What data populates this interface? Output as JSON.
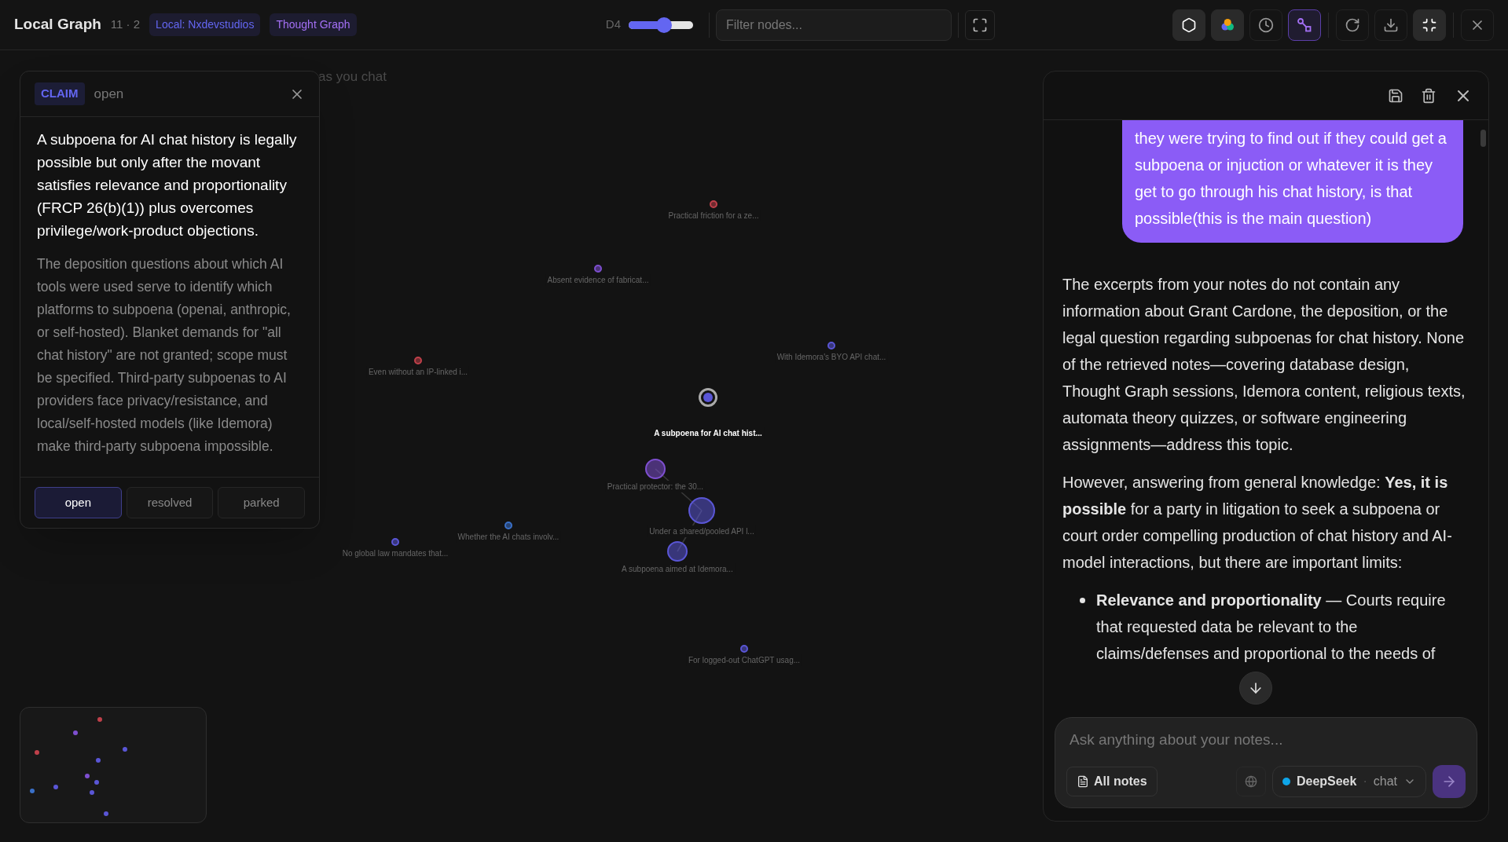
{
  "header": {
    "title": "Local Graph",
    "counts": "11 · 2",
    "tags": [
      {
        "label": "Local: Nxdevstudios",
        "color": "#6366f1"
      },
      {
        "label": "Thought Graph",
        "color": "#a470f5"
      }
    ],
    "depth": {
      "label": "D4",
      "level": 0.55
    },
    "filter": {
      "placeholder": "Filter nodes..."
    }
  },
  "toolbar": [
    {
      "kind": "hexagon",
      "on": true,
      "selected": false
    },
    {
      "kind": "colors",
      "on": true,
      "selected": false
    },
    {
      "kind": "clock",
      "on": false,
      "selected": false
    },
    {
      "kind": "link",
      "on": false,
      "selected": true
    },
    {
      "kind": "refresh",
      "on": false,
      "selected": false
    },
    {
      "kind": "download",
      "on": false,
      "selected": false
    },
    {
      "kind": "compress",
      "on": true,
      "selected": false
    },
    {
      "kind": "close",
      "on": false,
      "selected": false
    }
  ],
  "canvas": {
    "hint": "as you chat",
    "nodes": [
      {
        "label": "Practical friction for a ze...",
        "color": "#c0404a",
        "selected": false,
        "linked_to_next": false
      },
      {
        "label": "Absent evidence of fabricat...",
        "color": "#7e4fd0",
        "selected": false,
        "linked_to_next": false
      },
      {
        "label": "Even without an IP-linked i...",
        "color": "#c0404a",
        "selected": false,
        "linked_to_next": false
      },
      {
        "label": "With Idemora's BYO API chat...",
        "color": "#5a56d6",
        "selected": false,
        "linked_to_next": false
      },
      {
        "label": "A subpoena for AI chat hist...",
        "color": "#5a56d6",
        "selected": true,
        "linked_to_next": false
      },
      {
        "label": "Practical protector: the 30...",
        "color": "#7e4fd0",
        "selected": false,
        "linked_to_next": true
      },
      {
        "label": "Under a shared/pooled API l...",
        "color": "#5a56d6",
        "selected": false,
        "linked_to_next": true
      },
      {
        "label": "A subpoena aimed at Idemora...",
        "color": "#5a56d6",
        "selected": false,
        "linked_to_next": false
      },
      {
        "label": "Whether the AI chats involv...",
        "color": "#3a70c8",
        "selected": false,
        "linked_to_next": false
      },
      {
        "label": "No global law mandates that...",
        "color": "#5a56d6",
        "selected": false,
        "linked_to_next": false
      },
      {
        "label": "For logged-out ChatGPT usag...",
        "color": "#5a56d6",
        "selected": false,
        "linked_to_next": false
      }
    ]
  },
  "claim_card": {
    "badge": "CLAIM",
    "status": "open",
    "title": "A subpoena for AI chat history is legally possible but only after the movant satisfies relevance and proportionality (FRCP 26(b)(1)) plus overcomes privilege/work-product objections.",
    "body": "The deposition questions about which AI tools were used serve to identify which platforms to subpoena (openai, anthropic, or self-hosted). Blanket demands for \"all chat history\" are not granted; scope must be specified. Third-party subpoenas to AI providers face privacy/resistance, and local/self-hosted models (like Idemora) make third-party subpoena impossible.",
    "status_options": [
      {
        "label": "open",
        "selected": true
      },
      {
        "label": "resolved",
        "selected": false
      },
      {
        "label": "parked",
        "selected": false
      }
    ]
  },
  "chat": {
    "user_message": "they were trying to find out if they could get a subpoena or injuction or whatever it is they get to go through his chat history, is that possible(this is the main question)",
    "assistant": [
      {
        "kind": "paragraph",
        "text": "The excerpts from your notes do not contain any information about Grant Cardone, the deposition, or the legal question regarding subpoenas for chat history. None of the retrieved notes—covering database design, Thought Graph sessions, Idemora content, religious texts, automata theory quizzes, or software engineering assignments—address this topic."
      },
      {
        "kind": "paragraph",
        "text": "However, answering from general knowledge: **Yes, it is possible** for a party in litigation to seek a subpoena or court order compelling production of chat history and AI-model interactions, but there are important limits:"
      },
      {
        "kind": "bullet",
        "text": "**Relevance and proportionality** — Courts require that requested data be relevant to the claims/defenses and proportional to the needs of"
      }
    ],
    "input": {
      "placeholder": "Ask anything about your notes...",
      "scope": "All notes",
      "model": {
        "name": "DeepSeek",
        "separator": "·",
        "mode": "chat",
        "color": "#0ea5e9"
      },
      "send_disabled": true
    }
  }
}
